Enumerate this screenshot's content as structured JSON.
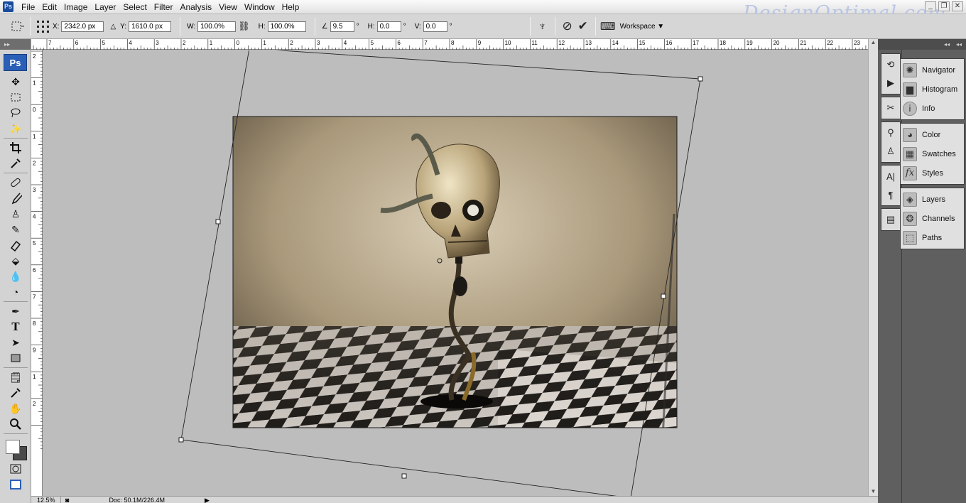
{
  "app": {
    "logo_text": "Ps",
    "watermark": "DesignOptimal.com"
  },
  "menu": [
    "File",
    "Edit",
    "Image",
    "Layer",
    "Select",
    "Filter",
    "Analysis",
    "View",
    "Window",
    "Help"
  ],
  "window_controls": {
    "minimize": "_",
    "restore": "❐",
    "close": "✕"
  },
  "options_bar": {
    "x_label": "X:",
    "x_value": "2342.0 px",
    "y_label": "Y:",
    "y_value": "1610.0 px",
    "w_label": "W:",
    "w_value": "100.0%",
    "h_label": "H:",
    "h_value": "100.0%",
    "angle_value": "9.5",
    "angle_unit": "°",
    "hskew_label": "H:",
    "hskew_value": "0.0",
    "hskew_unit": "°",
    "vskew_label": "V:",
    "vskew_value": "0.0",
    "vskew_unit": "°",
    "workspace_label": "Workspace"
  },
  "ruler_top_labels": [
    "7",
    "6",
    "5",
    "4",
    "3",
    "2",
    "1",
    "0",
    "1",
    "2",
    "3",
    "4",
    "5",
    "6",
    "7",
    "8",
    "9",
    "10",
    "11",
    "12",
    "13",
    "14",
    "15",
    "16",
    "17",
    "18",
    "19",
    "20",
    "21",
    "22",
    "23"
  ],
  "ruler_left_labels": [
    "2",
    "1",
    "0",
    "1",
    "2",
    "3",
    "4",
    "5",
    "6",
    "7",
    "8",
    "9",
    "1",
    "2"
  ],
  "toolbox": {
    "badge": "Ps"
  },
  "status": {
    "zoom": "12.5%",
    "doc": "Doc: 50.1M/226.4M"
  },
  "panels": [
    {
      "items": [
        "Navigator",
        "Histogram",
        "Info"
      ]
    },
    {
      "items": [
        "Color",
        "Swatches",
        "Styles"
      ]
    },
    {
      "items": [
        "Layers",
        "Channels",
        "Paths"
      ]
    }
  ],
  "colors": {
    "canvas_bg": "#bdbdbd",
    "panel_dock": "#5f5f5f",
    "toolbar": "#d3d3d3"
  }
}
